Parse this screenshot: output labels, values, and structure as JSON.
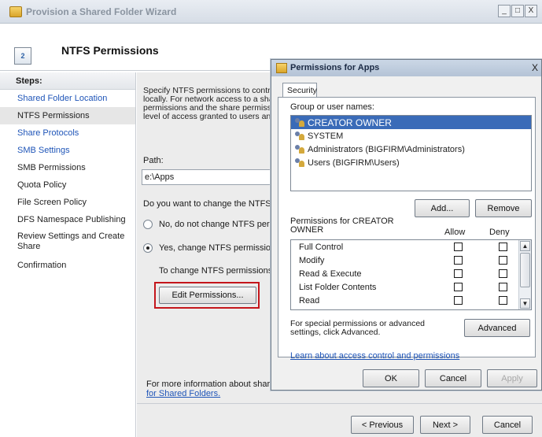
{
  "wizard": {
    "title": "Provision a Shared Folder Wizard",
    "window_buttons": {
      "minimize": "_",
      "restore": "□",
      "close": "X"
    },
    "header_title": "NTFS Permissions",
    "steps_label": "Steps:",
    "steps": [
      {
        "label": "Shared Folder Location"
      },
      {
        "label": "NTFS Permissions"
      },
      {
        "label": "Share Protocols"
      },
      {
        "label": "SMB Settings"
      },
      {
        "label": "SMB Permissions"
      },
      {
        "label": "Quota Policy"
      },
      {
        "label": "File Screen Policy"
      },
      {
        "label": "DFS Namespace Publishing"
      },
      {
        "label": "Review Settings and Create Share"
      },
      {
        "label": "Confirmation"
      }
    ],
    "description": [
      "Specify NTFS permissions to control",
      "locally. For network access to a shar",
      "permissions and the share permissior",
      "level of access granted to users and"
    ],
    "path_label": "Path:",
    "path_value": "e:\\Apps",
    "question": "Do you want to change the NTFS p",
    "option_no": "No, do not change NTFS permi",
    "option_yes": "Yes, change NTFS permissions",
    "change_note": "To change NTFS permissions, c",
    "edit_button": "Edit Permissions...",
    "more_info": "For more information about sharin",
    "more_info_link": "for Shared Folders.",
    "prev_button": "< Previous",
    "next_button": "Next >",
    "cancel_button": "Cancel"
  },
  "dialog": {
    "title": "Permissions for Apps",
    "close": "X",
    "tab": "Security",
    "group_label": "Group or user names:",
    "users": [
      "CREATOR OWNER",
      "SYSTEM",
      "Administrators (BIGFIRM\\Administrators)",
      "Users (BIGFIRM\\Users)"
    ],
    "add_button": "Add...",
    "remove_button": "Remove",
    "permissions_for": "Permissions for CREATOR OWNER",
    "allow_label": "Allow",
    "deny_label": "Deny",
    "permissions": [
      {
        "name": "Full Control",
        "allow": false,
        "deny": false
      },
      {
        "name": "Modify",
        "allow": false,
        "deny": false
      },
      {
        "name": "Read & Execute",
        "allow": false,
        "deny": false
      },
      {
        "name": "List Folder Contents",
        "allow": false,
        "deny": false
      },
      {
        "name": "Read",
        "allow": false,
        "deny": false
      }
    ],
    "special_text": "For special permissions or advanced settings, click Advanced.",
    "advanced_button": "Advanced",
    "learn_link": "Learn about access control and permissions",
    "ok_button": "OK",
    "cancel_button": "Cancel",
    "apply_button": "Apply"
  }
}
